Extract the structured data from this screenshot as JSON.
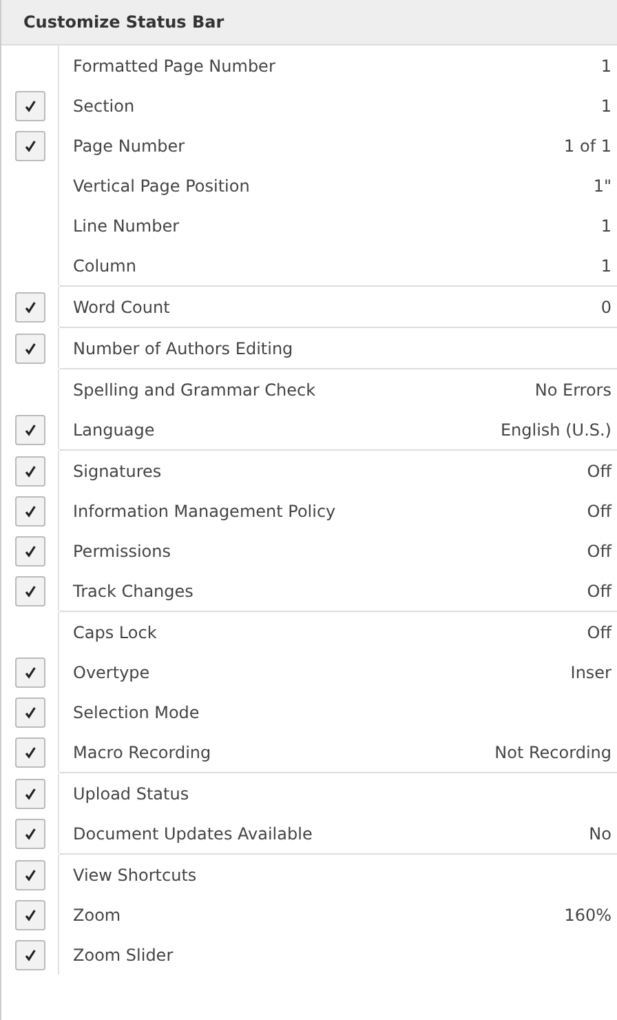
{
  "menu": {
    "title": "Customize Status Bar",
    "groups": [
      {
        "items": [
          {
            "label": "Formatted Page Number",
            "value": "1",
            "checked": false
          },
          {
            "label": "Section",
            "value": "1",
            "checked": true
          },
          {
            "label": "Page Number",
            "value": "1 of 1",
            "checked": true
          },
          {
            "label": "Vertical Page Position",
            "value": "1\"",
            "checked": false
          },
          {
            "label": "Line Number",
            "value": "1",
            "checked": false
          },
          {
            "label": "Column",
            "value": "1",
            "checked": false
          }
        ]
      },
      {
        "items": [
          {
            "label": "Word Count",
            "value": "0",
            "checked": true
          }
        ]
      },
      {
        "items": [
          {
            "label": "Number of Authors Editing",
            "checked": true
          }
        ]
      },
      {
        "items": [
          {
            "label": "Spelling and Grammar Check",
            "value": "No Errors",
            "checked": false
          },
          {
            "label": "Language",
            "value": "English (U.S.)",
            "checked": true
          }
        ]
      },
      {
        "items": [
          {
            "label": "Signatures",
            "value": "Off",
            "checked": true
          },
          {
            "label": "Information Management Policy",
            "value": "Off",
            "checked": true
          },
          {
            "label": "Permissions",
            "value": "Off",
            "checked": true
          },
          {
            "label": "Track Changes",
            "value": "Off",
            "checked": true
          }
        ]
      },
      {
        "items": [
          {
            "label": "Caps Lock",
            "value": "Off",
            "checked": false
          },
          {
            "label": "Overtype",
            "value": "Inser",
            "checked": true
          },
          {
            "label": "Selection Mode",
            "checked": true
          },
          {
            "label": "Macro Recording",
            "value": "Not Recording",
            "checked": true
          }
        ]
      },
      {
        "items": [
          {
            "label": "Upload Status",
            "checked": true
          },
          {
            "label": "Document Updates Available",
            "value": "No",
            "checked": true
          }
        ]
      },
      {
        "items": [
          {
            "label": "View Shortcuts",
            "checked": true
          },
          {
            "label": "Zoom",
            "value": "160%",
            "checked": true
          },
          {
            "label": "Zoom Slider",
            "checked": true
          }
        ]
      }
    ]
  }
}
